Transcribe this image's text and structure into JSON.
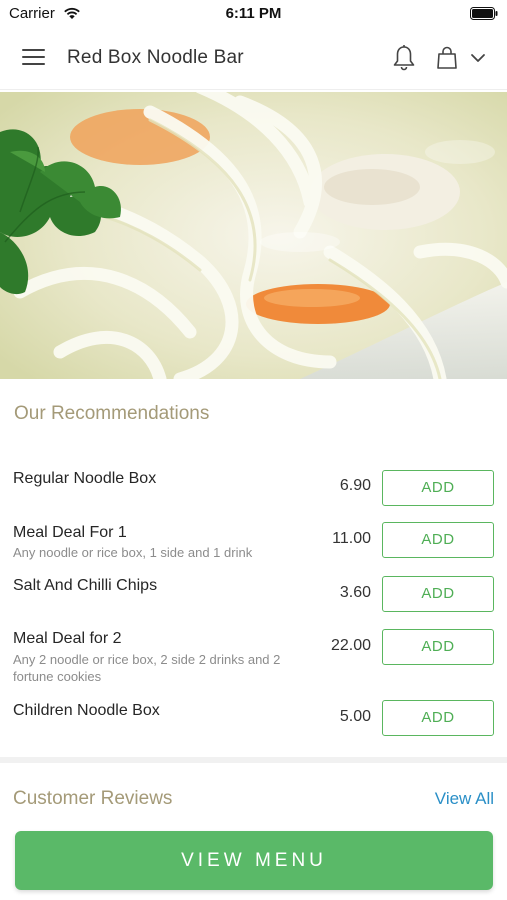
{
  "status_bar": {
    "carrier": "Carrier",
    "time": "6:11 PM",
    "wifi_icon": "wifi-icon",
    "battery_icon": "battery-icon"
  },
  "header": {
    "title": "Red Box Noodle Bar",
    "menu_icon": "hamburger-menu-icon",
    "bell_icon": "bell-icon",
    "bag_icon": "shopping-bag-icon",
    "chevron_icon": "chevron-down-icon"
  },
  "recommendations": {
    "title": "Our Recommendations",
    "items": [
      {
        "name": "Regular Noodle Box",
        "description": "",
        "price": "6.90",
        "add_label": "ADD"
      },
      {
        "name": "Meal Deal For 1",
        "description": "Any noodle or rice box, 1 side and 1 drink",
        "price": "11.00",
        "add_label": "ADD"
      },
      {
        "name": "Salt And Chilli Chips",
        "description": "",
        "price": "3.60",
        "add_label": "ADD"
      },
      {
        "name": "Meal Deal for 2",
        "description": "Any 2 noodle or rice box, 2 side 2 drinks and 2 fortune cookies",
        "price": "22.00",
        "add_label": "ADD"
      },
      {
        "name": "Children Noodle Box",
        "description": "",
        "price": "5.00",
        "add_label": "ADD"
      }
    ]
  },
  "reviews": {
    "title": "Customer Reviews",
    "view_all_label": "View All"
  },
  "footer": {
    "view_menu_label": "VIEW MENU"
  },
  "colors": {
    "accent_green": "#5ab968",
    "section_title": "#a49a78",
    "link_blue": "#2a8fc7"
  }
}
